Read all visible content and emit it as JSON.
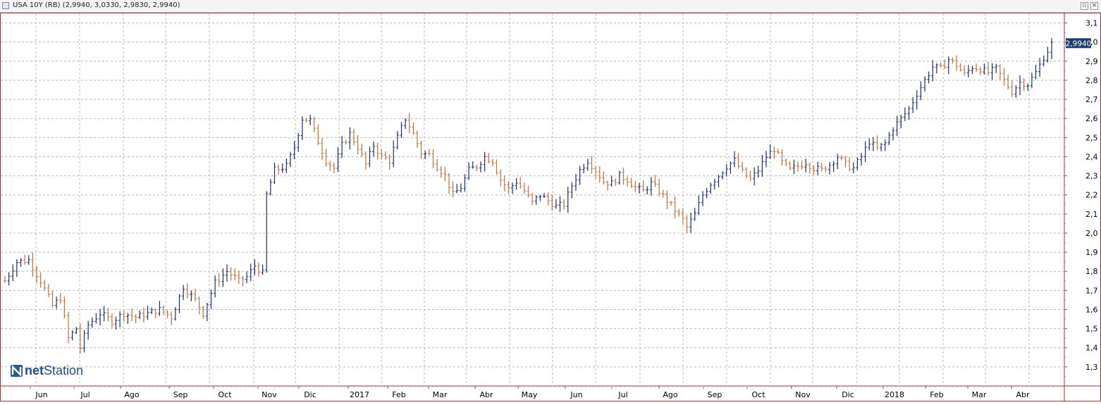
{
  "window": {
    "title": "USA 10Y (RB) (2,9940, 3,0330, 2,9830, 2,9940)"
  },
  "logo": {
    "prefix": "net",
    "suffix": "Station"
  },
  "colors": {
    "up": "#1a2e6e",
    "down": "#c0703c",
    "frame": "#a03030",
    "grid": "#b8b8b8",
    "last_badge": "#1f3c6e"
  },
  "chart_data": {
    "type": "ohlc",
    "y_ticks": [
      "1,3",
      "1,4",
      "1,5",
      "1,6",
      "1,7",
      "1,8",
      "1,9",
      "2,0",
      "2,1",
      "2,2",
      "2,3",
      "2,4",
      "2,5",
      "2,6",
      "2,7",
      "2,8",
      "2,9",
      "3,0",
      "3,1"
    ],
    "ylim": [
      1.2,
      3.15
    ],
    "x_ticks": [
      "Jun",
      "Jul",
      "Ago",
      "Sep",
      "Oct",
      "Nov",
      "Dic",
      "2017",
      "Feb",
      "Mar",
      "Abr",
      "May",
      "Jun",
      "Jul",
      "Ago",
      "Sep",
      "Oct",
      "Nov",
      "Dic",
      "2018",
      "Feb",
      "Mar",
      "Abr"
    ],
    "last_value": "2,9940",
    "close_path": [
      [
        0,
        1.75
      ],
      [
        3,
        1.85
      ],
      [
        6,
        1.86
      ],
      [
        9,
        1.75
      ],
      [
        12,
        1.62
      ],
      [
        14,
        1.66
      ],
      [
        16,
        1.45
      ],
      [
        18,
        1.5
      ],
      [
        19,
        1.4
      ],
      [
        21,
        1.52
      ],
      [
        24,
        1.58
      ],
      [
        27,
        1.54
      ],
      [
        30,
        1.58
      ],
      [
        33,
        1.56
      ],
      [
        36,
        1.58
      ],
      [
        39,
        1.6
      ],
      [
        42,
        1.56
      ],
      [
        45,
        1.72
      ],
      [
        48,
        1.65
      ],
      [
        50,
        1.58
      ],
      [
        53,
        1.74
      ],
      [
        56,
        1.8
      ],
      [
        59,
        1.75
      ],
      [
        61,
        1.77
      ],
      [
        63,
        1.83
      ],
      [
        65,
        1.79
      ],
      [
        66,
        2.2
      ],
      [
        68,
        2.33
      ],
      [
        71,
        2.35
      ],
      [
        73,
        2.45
      ],
      [
        75,
        2.6
      ],
      [
        77,
        2.59
      ],
      [
        79,
        2.48
      ],
      [
        81,
        2.38
      ],
      [
        83,
        2.34
      ],
      [
        85,
        2.46
      ],
      [
        87,
        2.52
      ],
      [
        89,
        2.45
      ],
      [
        91,
        2.36
      ],
      [
        93,
        2.46
      ],
      [
        95,
        2.4
      ],
      [
        97,
        2.38
      ],
      [
        99,
        2.5
      ],
      [
        101,
        2.6
      ],
      [
        103,
        2.52
      ],
      [
        105,
        2.42
      ],
      [
        107,
        2.41
      ],
      [
        109,
        2.35
      ],
      [
        111,
        2.3
      ],
      [
        113,
        2.2
      ],
      [
        115,
        2.24
      ],
      [
        117,
        2.33
      ],
      [
        119,
        2.35
      ],
      [
        121,
        2.4
      ],
      [
        123,
        2.38
      ],
      [
        125,
        2.28
      ],
      [
        127,
        2.23
      ],
      [
        129,
        2.27
      ],
      [
        131,
        2.22
      ],
      [
        133,
        2.16
      ],
      [
        135,
        2.2
      ],
      [
        137,
        2.17
      ],
      [
        139,
        2.14
      ],
      [
        141,
        2.15
      ],
      [
        143,
        2.25
      ],
      [
        145,
        2.33
      ],
      [
        147,
        2.38
      ],
      [
        149,
        2.33
      ],
      [
        151,
        2.27
      ],
      [
        153,
        2.26
      ],
      [
        155,
        2.3
      ],
      [
        157,
        2.28
      ],
      [
        159,
        2.24
      ],
      [
        161,
        2.22
      ],
      [
        163,
        2.26
      ],
      [
        165,
        2.22
      ],
      [
        167,
        2.17
      ],
      [
        169,
        2.12
      ],
      [
        171,
        2.07
      ],
      [
        172,
        2.03
      ],
      [
        174,
        2.1
      ],
      [
        176,
        2.2
      ],
      [
        178,
        2.26
      ],
      [
        180,
        2.3
      ],
      [
        182,
        2.35
      ],
      [
        184,
        2.38
      ],
      [
        186,
        2.32
      ],
      [
        188,
        2.28
      ],
      [
        190,
        2.33
      ],
      [
        192,
        2.4
      ],
      [
        194,
        2.44
      ],
      [
        196,
        2.37
      ],
      [
        198,
        2.33
      ],
      [
        200,
        2.35
      ],
      [
        202,
        2.37
      ],
      [
        204,
        2.34
      ],
      [
        206,
        2.33
      ],
      [
        208,
        2.36
      ],
      [
        210,
        2.4
      ],
      [
        212,
        2.36
      ],
      [
        214,
        2.34
      ],
      [
        216,
        2.4
      ],
      [
        218,
        2.48
      ],
      [
        220,
        2.44
      ],
      [
        222,
        2.47
      ],
      [
        224,
        2.55
      ],
      [
        226,
        2.6
      ],
      [
        228,
        2.65
      ],
      [
        230,
        2.73
      ],
      [
        232,
        2.8
      ],
      [
        234,
        2.87
      ],
      [
        236,
        2.86
      ],
      [
        238,
        2.91
      ],
      [
        240,
        2.88
      ],
      [
        242,
        2.83
      ],
      [
        244,
        2.87
      ],
      [
        246,
        2.86
      ],
      [
        248,
        2.84
      ],
      [
        250,
        2.86
      ],
      [
        252,
        2.8
      ],
      [
        254,
        2.74
      ],
      [
        256,
        2.79
      ],
      [
        258,
        2.78
      ],
      [
        260,
        2.84
      ],
      [
        262,
        2.92
      ],
      [
        264,
        2.99
      ]
    ]
  }
}
